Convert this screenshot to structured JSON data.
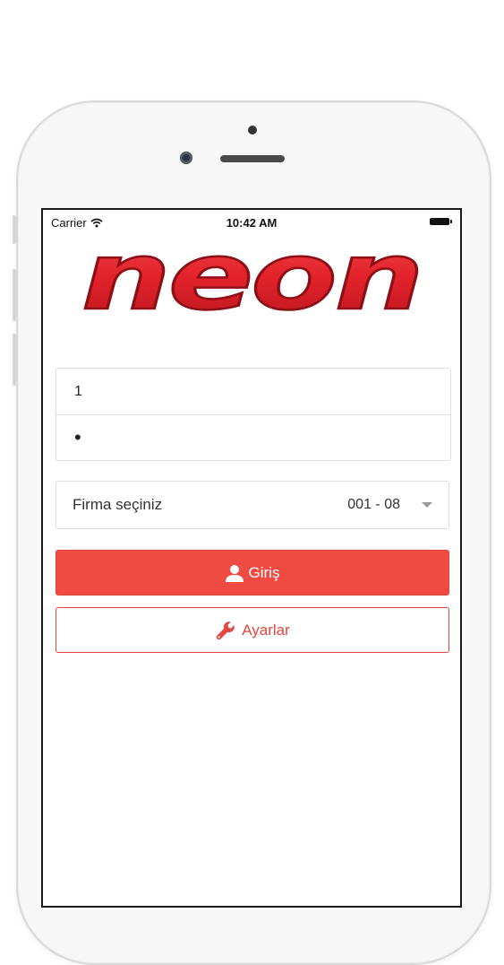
{
  "status_bar": {
    "carrier": "Carrier",
    "time": "10:42 AM"
  },
  "logo": {
    "text": "neon",
    "color": "#e3232b"
  },
  "login_form": {
    "username_value": "1",
    "password_value": "•"
  },
  "company_select": {
    "label": "Firma seçiniz",
    "selected_value": "001 - 08"
  },
  "buttons": {
    "login_label": "Giriş",
    "settings_label": "Ayarlar"
  },
  "icons": {
    "wifi": "wifi-icon",
    "battery": "battery-icon",
    "user": "user-icon",
    "wrench": "wrench-icon",
    "caret": "chevron-down-icon"
  },
  "colors": {
    "accent": "#ef4b43",
    "border": "#dddddd"
  }
}
